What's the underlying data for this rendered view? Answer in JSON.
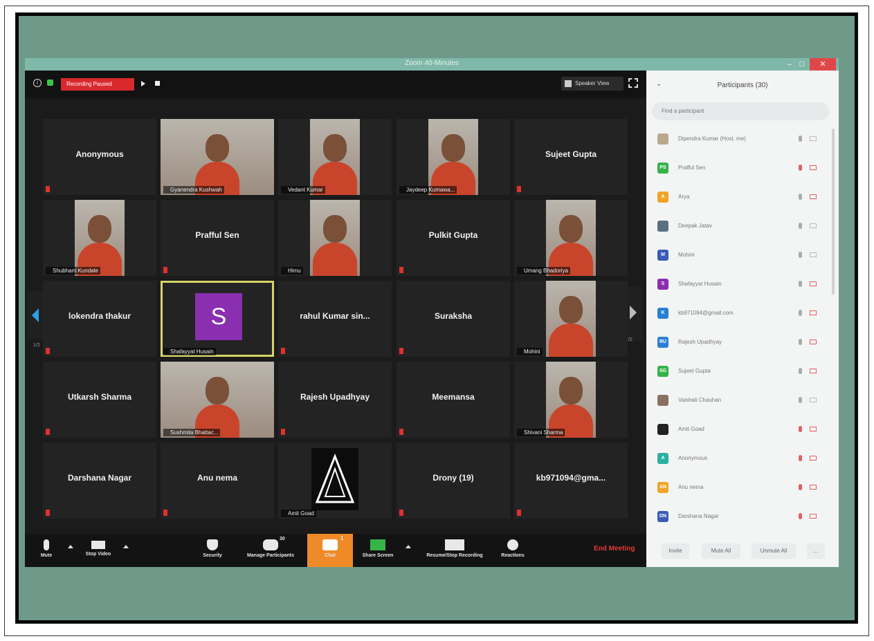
{
  "window": {
    "title": "Zoom 40-Minutes"
  },
  "topbar": {
    "recording_badge": "Recording Paused",
    "speaker_view": "Speaker View"
  },
  "tiles": [
    {
      "name": "Anonymous",
      "video": false
    },
    {
      "name": "Gyanendra Kushwah",
      "video": true
    },
    {
      "name": "Vedant Kumar",
      "video": true
    },
    {
      "name": "Jaydeep Kumawa...",
      "video": true
    },
    {
      "name": "Sujeet Gupta",
      "video": false
    },
    {
      "name": "Shubham Kundale",
      "video": true
    },
    {
      "name": "Prafful Sen",
      "video": false
    },
    {
      "name": "Himu",
      "video": true
    },
    {
      "name": "Pulkit Gupta",
      "video": false
    },
    {
      "name": "Umang Bhadoriya",
      "video": true
    },
    {
      "name": "lokendra thakur",
      "video": false
    },
    {
      "name": "Shafayyat Husain",
      "video": false,
      "avatar": "S",
      "active": true
    },
    {
      "name": "rahul Kumar sin...",
      "video": false
    },
    {
      "name": "Suraksha",
      "video": false
    },
    {
      "name": "Mohini",
      "video": true
    },
    {
      "name": "Utkarsh Sharma",
      "video": false
    },
    {
      "name": "Sushmita Bhattac...",
      "video": true
    },
    {
      "name": "Rajesh Upadhyay",
      "video": false
    },
    {
      "name": "Meemansa",
      "video": false
    },
    {
      "name": "Shivani Sharma",
      "video": true
    },
    {
      "name": "Darshana Nagar",
      "video": false
    },
    {
      "name": "Anu nema",
      "video": false
    },
    {
      "name": "Amit Goad",
      "video": true,
      "logo": true
    },
    {
      "name": "Drony (19)",
      "video": false
    },
    {
      "name": "kb971094@gma...",
      "video": false
    }
  ],
  "page_indicator": {
    "left": "1/2",
    "right": "2/2"
  },
  "toolbar": {
    "mute": "Mute",
    "stop_video": "Stop Video",
    "security": "Security",
    "manage_participants": "Manage Participants",
    "participants_count": "30",
    "chat": "Chat",
    "chat_badge": "1",
    "share_screen": "Share Screen",
    "recording": "Resume/Stop Recording",
    "reactions": "Reactions",
    "end_meeting": "End Meeting"
  },
  "panel": {
    "title": "Participants (30)",
    "search_placeholder": "Find a participant",
    "participants": [
      {
        "name": "Dipendra Kumar (Host, me)",
        "initials": "",
        "color": "#b9a98c",
        "mic_muted": false,
        "cam_off": false
      },
      {
        "name": "Prafful Sen",
        "initials": "PS",
        "color": "#36b24a",
        "mic_muted": true,
        "cam_off": true
      },
      {
        "name": "Arya",
        "initials": "A",
        "color": "#f1a428",
        "mic_muted": false,
        "cam_off": true
      },
      {
        "name": "Deepak Jatav",
        "initials": "",
        "color": "#5a7080",
        "mic_muted": false,
        "cam_off": false
      },
      {
        "name": "Mohini",
        "initials": "M",
        "color": "#3b5bb4",
        "mic_muted": false,
        "cam_off": false
      },
      {
        "name": "Shafayyat Husain",
        "initials": "S",
        "color": "#8a2fb0",
        "mic_muted": false,
        "cam_off": true
      },
      {
        "name": "kb971094@gmail.com",
        "initials": "K",
        "color": "#2a7fd4",
        "mic_muted": false,
        "cam_off": true
      },
      {
        "name": "Rajesh Upadhyay",
        "initials": "RU",
        "color": "#2a7fd4",
        "mic_muted": false,
        "cam_off": true
      },
      {
        "name": "Sujeet Gupta",
        "initials": "SG",
        "color": "#36b24a",
        "mic_muted": false,
        "cam_off": true
      },
      {
        "name": "Vaishali Chauhan",
        "initials": "",
        "color": "#8a7060",
        "mic_muted": false,
        "cam_off": false
      },
      {
        "name": "Amit Goad",
        "initials": "",
        "color": "#222222",
        "mic_muted": true,
        "cam_off": true
      },
      {
        "name": "Anonymous",
        "initials": "A",
        "color": "#2bb0a0",
        "mic_muted": true,
        "cam_off": true
      },
      {
        "name": "Anu nema",
        "initials": "AN",
        "color": "#f1a428",
        "mic_muted": true,
        "cam_off": true
      },
      {
        "name": "Darshana Nagar",
        "initials": "DN",
        "color": "#3b5bb4",
        "mic_muted": true,
        "cam_off": true
      }
    ],
    "footer": {
      "invite": "Invite",
      "mute_all": "Mute All",
      "unmute_all": "Unmute All",
      "more": "..."
    }
  }
}
